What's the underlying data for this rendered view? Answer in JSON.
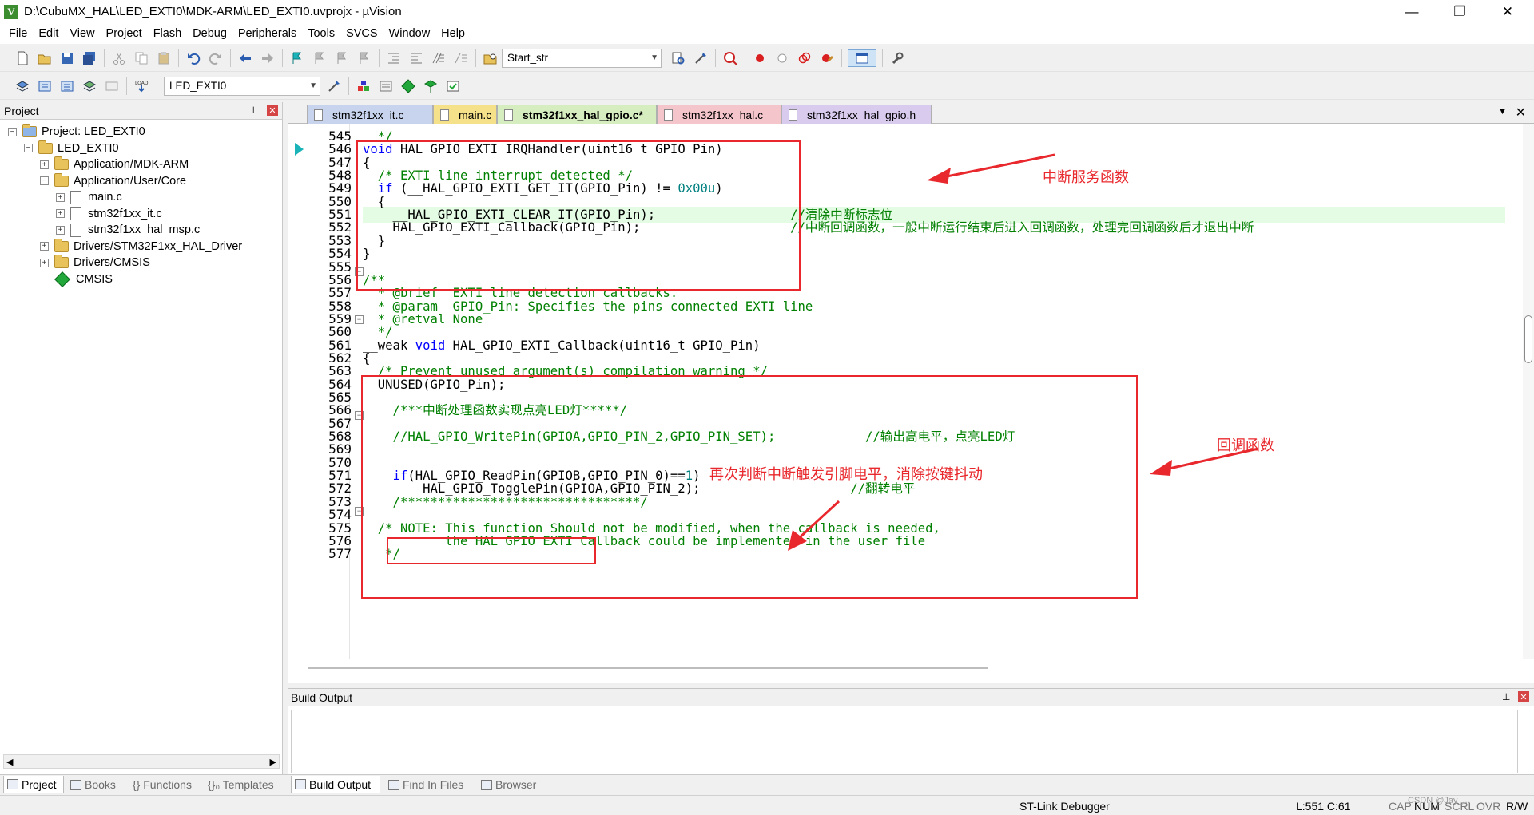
{
  "window": {
    "title": "D:\\CubuMX_HAL\\LED_EXTI0\\MDK-ARM\\LED_EXTI0.uvprojx - µVision",
    "icon_letter": "V",
    "minimize": "—",
    "restore": "❐",
    "close": "✕"
  },
  "menu": [
    "File",
    "Edit",
    "View",
    "Project",
    "Flash",
    "Debug",
    "Peripherals",
    "Tools",
    "SVCS",
    "Window",
    "Help"
  ],
  "toolbar1": {
    "find_combo_value": "Start_str"
  },
  "toolbar2": {
    "load_label": "LOAD",
    "target_combo_value": "LED_EXTI0"
  },
  "project_panel": {
    "title": "Project",
    "pin": "⊥",
    "close": "✕",
    "tree": [
      {
        "label": "Project: LED_EXTI0",
        "level": 0,
        "expander": "−",
        "icon": "project"
      },
      {
        "label": "LED_EXTI0",
        "level": 1,
        "expander": "−",
        "icon": "target"
      },
      {
        "label": "Application/MDK-ARM",
        "level": 2,
        "expander": "+",
        "icon": "folder"
      },
      {
        "label": "Application/User/Core",
        "level": 2,
        "expander": "−",
        "icon": "folder"
      },
      {
        "label": "main.c",
        "level": 3,
        "expander": "+",
        "icon": "file"
      },
      {
        "label": "stm32f1xx_it.c",
        "level": 3,
        "expander": "+",
        "icon": "file"
      },
      {
        "label": "stm32f1xx_hal_msp.c",
        "level": 3,
        "expander": "+",
        "icon": "file"
      },
      {
        "label": "Drivers/STM32F1xx_HAL_Driver",
        "level": 2,
        "expander": "+",
        "icon": "folder"
      },
      {
        "label": "Drivers/CMSIS",
        "level": 2,
        "expander": "+",
        "icon": "folder"
      },
      {
        "label": "CMSIS",
        "level": 2,
        "expander": "",
        "icon": "gem"
      }
    ]
  },
  "editor": {
    "tabs": [
      {
        "label": "stm32f1xx_it.c",
        "color": "#c8d4ee",
        "active": false
      },
      {
        "label": "main.c",
        "color": "#f5e18a",
        "active": false
      },
      {
        "label": "stm32f1xx_hal_gpio.c*",
        "color": "#d6edc0",
        "active": true
      },
      {
        "label": "stm32f1xx_hal.c",
        "color": "#f4c6cc",
        "active": false
      },
      {
        "label": "stm32f1xx_hal_gpio.h",
        "color": "#d8cbee",
        "active": false
      }
    ],
    "tab_menu": "▼",
    "tab_close": "✕",
    "line_numbers": [
      "545",
      "546",
      "547",
      "548",
      "549",
      "550",
      "551",
      "552",
      "553",
      "554",
      "555",
      "556",
      "557",
      "558",
      "559",
      "560",
      "561",
      "562",
      "563",
      "564",
      "565",
      "566",
      "567",
      "568",
      "569",
      "570",
      "571",
      "572",
      "573",
      "574",
      "575",
      "576",
      "577"
    ],
    "lines": [
      [
        {
          "t": "  */",
          "c": "cm"
        }
      ],
      [
        {
          "t": "void",
          "c": "kw"
        },
        {
          "t": " HAL_GPIO_EXTI_IRQHandler(uint16_t GPIO_Pin)",
          "c": ""
        }
      ],
      [
        {
          "t": "{",
          "c": ""
        }
      ],
      [
        {
          "t": "  /* EXTI line interrupt detected */",
          "c": "cm"
        }
      ],
      [
        {
          "t": "  ",
          "c": ""
        },
        {
          "t": "if",
          "c": "kw"
        },
        {
          "t": " (__HAL_GPIO_EXTI_GET_IT(GPIO_Pin) != ",
          "c": ""
        },
        {
          "t": "0x00u",
          "c": "num"
        },
        {
          "t": ")",
          "c": ""
        }
      ],
      [
        {
          "t": "  {",
          "c": ""
        }
      ],
      [
        {
          "t": "    __HAL_GPIO_EXTI_CLEAR_IT(GPIO_Pin);                  ",
          "c": ""
        },
        {
          "t": "//清除中断标志位",
          "c": "cn"
        }
      ],
      [
        {
          "t": "    HAL_GPIO_EXTI_Callback(GPIO_Pin);                    ",
          "c": ""
        },
        {
          "t": "//中断回调函数，一般中断运行结束后进入回调函数，处理完回调函数后才退出中断",
          "c": "cn"
        }
      ],
      [
        {
          "t": "  }",
          "c": ""
        }
      ],
      [
        {
          "t": "}",
          "c": ""
        }
      ],
      [
        {
          "t": "",
          "c": ""
        }
      ],
      [
        {
          "t": "/**",
          "c": "cm"
        }
      ],
      [
        {
          "t": "  * @brief  EXTI line detection callbacks.",
          "c": "cm"
        }
      ],
      [
        {
          "t": "  * @param  GPIO_Pin: Specifies the pins connected EXTI line",
          "c": "cm"
        }
      ],
      [
        {
          "t": "  * @retval None",
          "c": "cm"
        }
      ],
      [
        {
          "t": "  */",
          "c": "cm"
        }
      ],
      [
        {
          "t": "__weak ",
          "c": ""
        },
        {
          "t": "void",
          "c": "kw"
        },
        {
          "t": " HAL_GPIO_EXTI_Callback(uint16_t GPIO_Pin)",
          "c": ""
        }
      ],
      [
        {
          "t": "{",
          "c": ""
        }
      ],
      [
        {
          "t": "  /* Prevent unused argument(s) compilation warning */",
          "c": "cm"
        }
      ],
      [
        {
          "t": "  UNUSED(GPIO_Pin);",
          "c": ""
        }
      ],
      [
        {
          "t": "",
          "c": ""
        }
      ],
      [
        {
          "t": "    /***中断处理函数实现点亮LED灯*****/",
          "c": "cm"
        }
      ],
      [
        {
          "t": "",
          "c": ""
        }
      ],
      [
        {
          "t": "    //HAL_GPIO_WritePin(GPIOA,GPIO_PIN_2,GPIO_PIN_SET);            ",
          "c": "cm"
        },
        {
          "t": "//输出高电平，点亮LED灯",
          "c": "cn"
        }
      ],
      [
        {
          "t": "",
          "c": ""
        }
      ],
      [
        {
          "t": "",
          "c": ""
        }
      ],
      [
        {
          "t": "    ",
          "c": ""
        },
        {
          "t": "if",
          "c": "kw"
        },
        {
          "t": "(HAL_GPIO_ReadPin(GPIOB,GPIO_PIN_0)==",
          "c": ""
        },
        {
          "t": "1",
          "c": "num"
        },
        {
          "t": ")",
          "c": ""
        }
      ],
      [
        {
          "t": "        HAL_GPIO_TogglePin(GPIOA,GPIO_PIN_2);                    ",
          "c": ""
        },
        {
          "t": "//翻转电平",
          "c": "cn"
        }
      ],
      [
        {
          "t": "    /********************************/",
          "c": "cm"
        }
      ],
      [
        {
          "t": "",
          "c": ""
        }
      ],
      [
        {
          "t": "  /* NOTE: This function Should not be modified, when the callback is needed,",
          "c": "cm"
        }
      ],
      [
        {
          "t": "           the HAL_GPIO_EXTI_Callback could be implemented in the user file",
          "c": "cm"
        }
      ],
      [
        {
          "t": "   */",
          "c": "cm"
        }
      ]
    ],
    "annotations": {
      "irq_label": "中断服务函数",
      "callback_label": "回调函数",
      "debounce_label": "再次判断中断触发引脚电平，消除按键抖动"
    }
  },
  "build_output": {
    "title": "Build Output",
    "pin": "⊥",
    "close": "✕"
  },
  "bottom_tabs": {
    "left": [
      "Project",
      "Books",
      "{} Functions",
      "{}₀ Templates"
    ],
    "right": [
      "Build Output",
      "Find In Files",
      "Browser"
    ]
  },
  "status": {
    "debugger": "ST-Link Debugger",
    "position": "L:551 C:61",
    "caps": "CAP",
    "num": "NUM",
    "scrl": "SCRL",
    "ovr": "OVR",
    "rw": "R/W",
    "watermark": "CSDN @Jay_..."
  }
}
